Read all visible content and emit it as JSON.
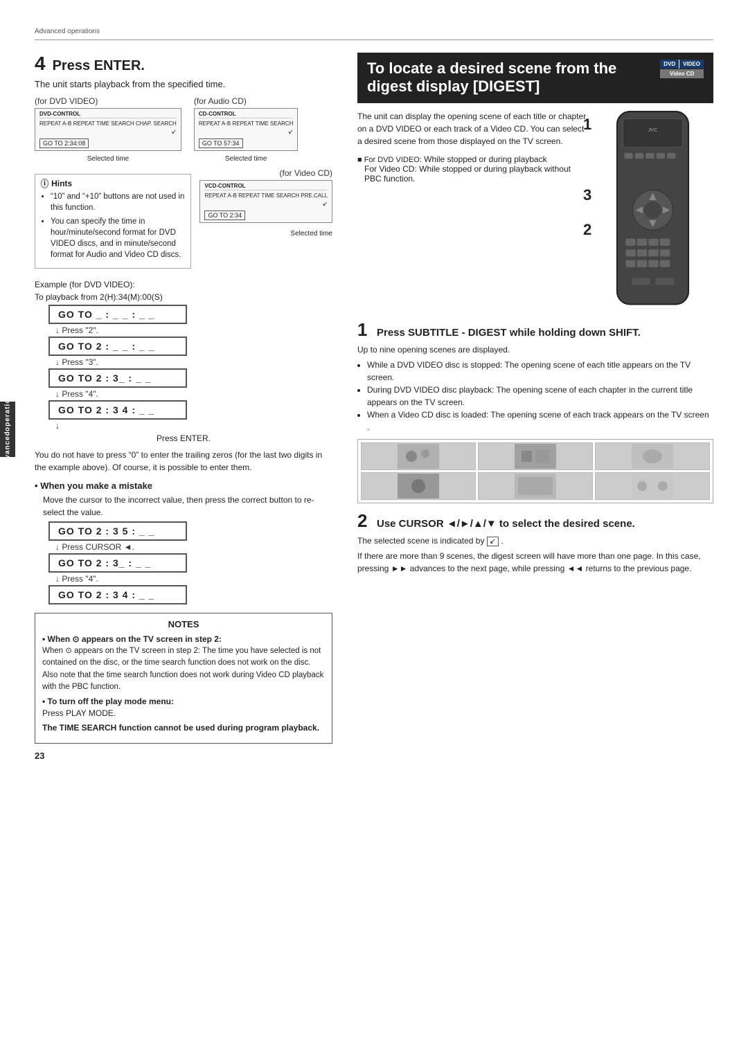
{
  "page": {
    "section_label": "Advanced operations",
    "page_number": "23"
  },
  "left": {
    "step_number": "4",
    "step_title": "Press ENTER.",
    "step_desc": "The unit starts playback from the specified time.",
    "dvd_video_label": "(for DVD VIDEO)",
    "audio_cd_label": "(for Audio CD)",
    "video_cd_label": "(for Video CD)",
    "dvd_ctrl_title": "DVD-CONTROL",
    "dvd_ctrl_options": "REPEAT  A-B REPEAT  TIME SEARCH  CHAP. SEARCH",
    "dvd_goto_value": "GO TO  2:34:08",
    "dvd_selected_time": "Selected time",
    "cd_ctrl_title": "CD-CONTROL",
    "cd_ctrl_options": "REPEAT  A-B REPEAT  TIME SEARCH",
    "cd_goto_value": "GO TO  57:34",
    "cd_selected_time": "Selected time",
    "vcd_ctrl_title": "VCD-CONTROL",
    "vcd_ctrl_options": "REPEAT  A-B REPEAT  TIME SEARCH  PRE.CALL",
    "vcd_goto_value": "GO TO  2:34",
    "vcd_selected_time": "Selected time",
    "hints_title": "Hints",
    "hints": [
      "“10” and “+10” buttons are not used in this function.",
      "You can specify the time in hour/minute/second format for DVD VIDEO discs, and in minute/second format for Audio and Video CD discs."
    ],
    "example_title": "Example (for DVD VIDEO):",
    "example_desc": "To playback from 2(H):34(M):00(S)",
    "goto_sequence": [
      {
        "display": "GO TO  _ : _ _  : _ _",
        "press": ""
      },
      {
        "display": "GO TO  2 : _ _  : _ _",
        "press": "↓ Press “2”."
      },
      {
        "display": "GO TO  2 : 3_  : _ _",
        "press": "↓ Press “3”."
      },
      {
        "display": "GO TO  2 : 3 4  : _ _",
        "press": "↓ Press “4”."
      },
      {
        "display": "GO TO  2 : 3 4  : _ _",
        "press": ""
      }
    ],
    "press_enter": "Press ENTER.",
    "body_text1": "You do not have to press “0” to enter the trailing zeros (for the last two digits in the example above). Of course, it is possible to enter them.",
    "when_mistake_title": "When you make a mistake",
    "when_mistake_desc": "Move the cursor to the incorrect value, then press the correct button to re-select the value.",
    "mistake_sequence": [
      {
        "display": "GO TO  2 : 3 5 : _ _",
        "press": ""
      },
      {
        "display": "",
        "press": "↓ Press CURSOR ◄."
      },
      {
        "display": "GO TO  2 : 3_  : _ _",
        "press": "↓ Press “4”."
      },
      {
        "display": "GO TO  2 : 3 4  : _ _",
        "press": ""
      }
    ],
    "notes_title": "NOTES",
    "notes": [
      "When ⊙ appears on the TV screen in step 2: The time you have selected is not contained on the disc, or the time search function does not work on the disc. Also note that the time search function does not work during Video CD playback with the PBC function.",
      "To turn off the play mode menu: Press PLAY MODE.",
      "The TIME SEARCH function cannot be used during program playback."
    ]
  },
  "right": {
    "header_title": "To locate a desired scene from the digest display [DIGEST]",
    "badge_dvd": "DVD",
    "badge_video": "VIDEO",
    "badge_cd": "Video CD",
    "intro": "The unit can display the opening scene of each title or chapter on a DVD VIDEO or each track of a Video CD. You can select a desired scene from those displayed on the TV screen.",
    "remote_numbers": [
      "1",
      "3",
      "2"
    ],
    "for_dvd_label": "■ For DVD VIDEO:",
    "for_dvd_desc": "While stopped or during playback",
    "for_vcd_label": "For Video CD:",
    "for_vcd_desc": "While stopped or during playback without PBC function.",
    "step1_num": "1",
    "step1_title": "Press SUBTITLE - DIGEST while holding down SHIFT.",
    "step1_desc": "Up to nine opening scenes are displayed.",
    "step1_bullets": [
      "While a DVD VIDEO disc is stopped: The opening scene of each title appears on the TV screen.",
      "During DVD VIDEO disc playback: The opening scene of each chapter in the current title appears on the TV screen.",
      "When a Video CD disc is loaded: The opening scene of each track appears on the TV screen ."
    ],
    "digest_images": [
      "scene1",
      "scene2",
      "scene3",
      "scene4",
      "scene5",
      "scene6"
    ],
    "step2_num": "2",
    "step2_title": "Use CURSOR ◄/►/▲/▼ to select the desired scene.",
    "step2_desc1": "The selected scene is indicated by",
    "step2_desc2": ".",
    "step2_note1": "If there are more than 9 scenes, the digest screen will have more than one page. In this case, pressing ►► advances to the next page, while pressing ◄◄ returns to the previous page."
  },
  "sidebar": {
    "label1": "Advanced",
    "label2": "operations"
  }
}
